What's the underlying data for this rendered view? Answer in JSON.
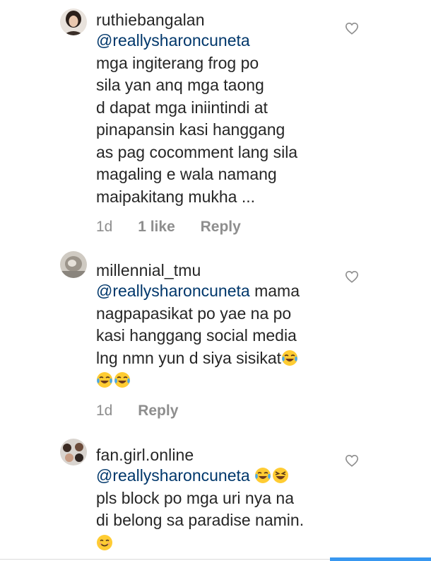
{
  "comments": [
    {
      "username": "ruthiebangalan",
      "mention": "@reallysharoncuneta",
      "text": "mga ingiterang frog po\nsila yan anq mga taong\nd dapat mga iniintindi at\npinapansin kasi hanggang\nas pag cocomment lang sila\nmagaling e wala namang\nmaipakitang mukha ...",
      "time": "1d",
      "likes": "1 like",
      "reply": "Reply",
      "avatar_icon": "profile-photo-icon",
      "like_icon": "heart-outline-icon"
    },
    {
      "username": "millennial_tmu",
      "mention": "@reallysharoncuneta",
      "text_part1": " mama\nnagpapasikat po yae na po\nkasi hanggang social media\nlng nmn yun d siya sisikat",
      "time": "1d",
      "reply": "Reply",
      "avatar_icon": "profile-photo-icon",
      "like_icon": "heart-outline-icon",
      "emojis": [
        "tears-of-joy-emoji",
        "tears-of-joy-emoji",
        "tears-of-joy-emoji"
      ]
    },
    {
      "username": "fan.girl.online",
      "mention": "@reallysharoncuneta",
      "text": "pls block po mga uri nya na\ndi belong sa paradise namin.",
      "avatar_icon": "profile-photo-icon",
      "like_icon": "heart-outline-icon",
      "emojis": [
        "tears-of-joy-emoji",
        "grinning-squinting-emoji",
        "smiling-emoji"
      ]
    }
  ],
  "colors": {
    "text": "#262626",
    "mention": "#00376b",
    "meta": "#8e8e8e",
    "accent": "#3897f0"
  }
}
